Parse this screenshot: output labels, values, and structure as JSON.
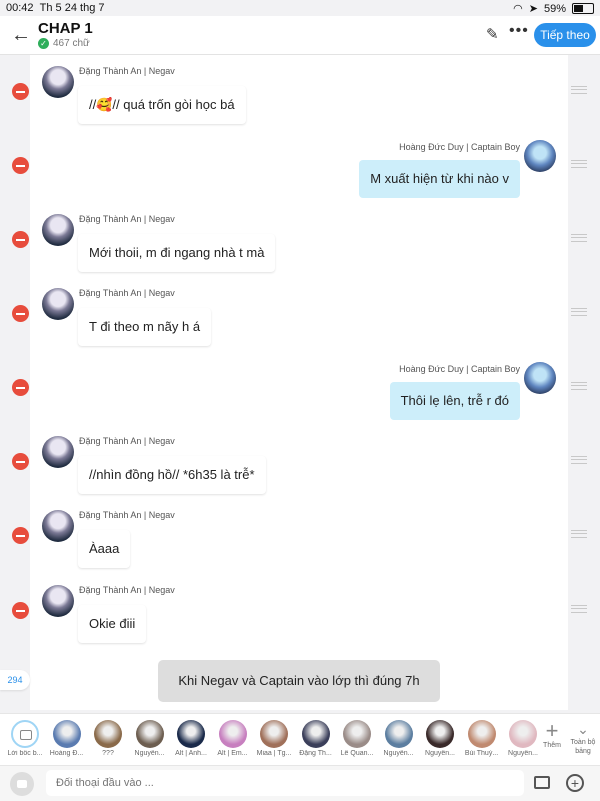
{
  "status": {
    "time": "00:42",
    "date": "Th 5 24 thg 7",
    "battery": "59%",
    "battery_level": 0.59
  },
  "header": {
    "title": "CHAP 1",
    "word_count": "467 chữ",
    "next_label": "Tiếp theo"
  },
  "messages": [
    {
      "sender": "Đặng Thành An | Negav",
      "text": "//🥰// quá trốn gòi học bá",
      "side": "in"
    },
    {
      "sender": "Hoàng Đức Duy | Captain Boy",
      "text": "M xuất hiện từ khi nào v",
      "side": "out"
    },
    {
      "sender": "Đặng Thành An | Negav",
      "text": "Mới thoii, m đi ngang nhà t mà",
      "side": "in"
    },
    {
      "sender": "Đặng Thành An | Negav",
      "text": "T đi theo m nãy h á",
      "side": "in"
    },
    {
      "sender": "Hoàng Đức Duy | Captain Boy",
      "text": "Thôi lẹ lên, trễ r đó",
      "side": "out"
    },
    {
      "sender": "Đặng Thành An | Negav",
      "text": "//nhìn đồng hồ// *6h35 là trễ*",
      "side": "in"
    },
    {
      "sender": "Đặng Thành An | Negav",
      "text": "Àaaa",
      "side": "in"
    },
    {
      "sender": "Đặng Thành An | Negav",
      "text": "Okie điii",
      "side": "in"
    }
  ],
  "narration": "Khi Negav và Captain vào lớp thì đúng 7h",
  "message_count": "294",
  "characters": [
    {
      "label": "Lời bốc b...",
      "color": "#ffffff"
    },
    {
      "label": "Hoàng Đ...",
      "color": "#5a7bb0"
    },
    {
      "label": "???",
      "color": "#8a6a4a"
    },
    {
      "label": "Nguyễn...",
      "color": "#6d5e50"
    },
    {
      "label": "Alt | Anh...",
      "color": "#1a2a4a"
    },
    {
      "label": "Alt | Em...",
      "color": "#c77fbf"
    },
    {
      "label": "Miaa | Tg...",
      "color": "#a0705a"
    },
    {
      "label": "Đặng Th...",
      "color": "#3b3f5a"
    },
    {
      "label": "Lê Quan...",
      "color": "#9a8c88"
    },
    {
      "label": "Nguyễn...",
      "color": "#5c7ea0"
    },
    {
      "label": "Nguyễn...",
      "color": "#3a2a2a"
    },
    {
      "label": "Bùi Thuỳ...",
      "color": "#c08a70"
    },
    {
      "label": "Nguyễn...",
      "color": "#e0b8c0"
    }
  ],
  "add_label": "Thêm",
  "all_label": "Toàn bộ bảng",
  "input": {
    "placeholder": "Đối thoại đầu vào ..."
  }
}
